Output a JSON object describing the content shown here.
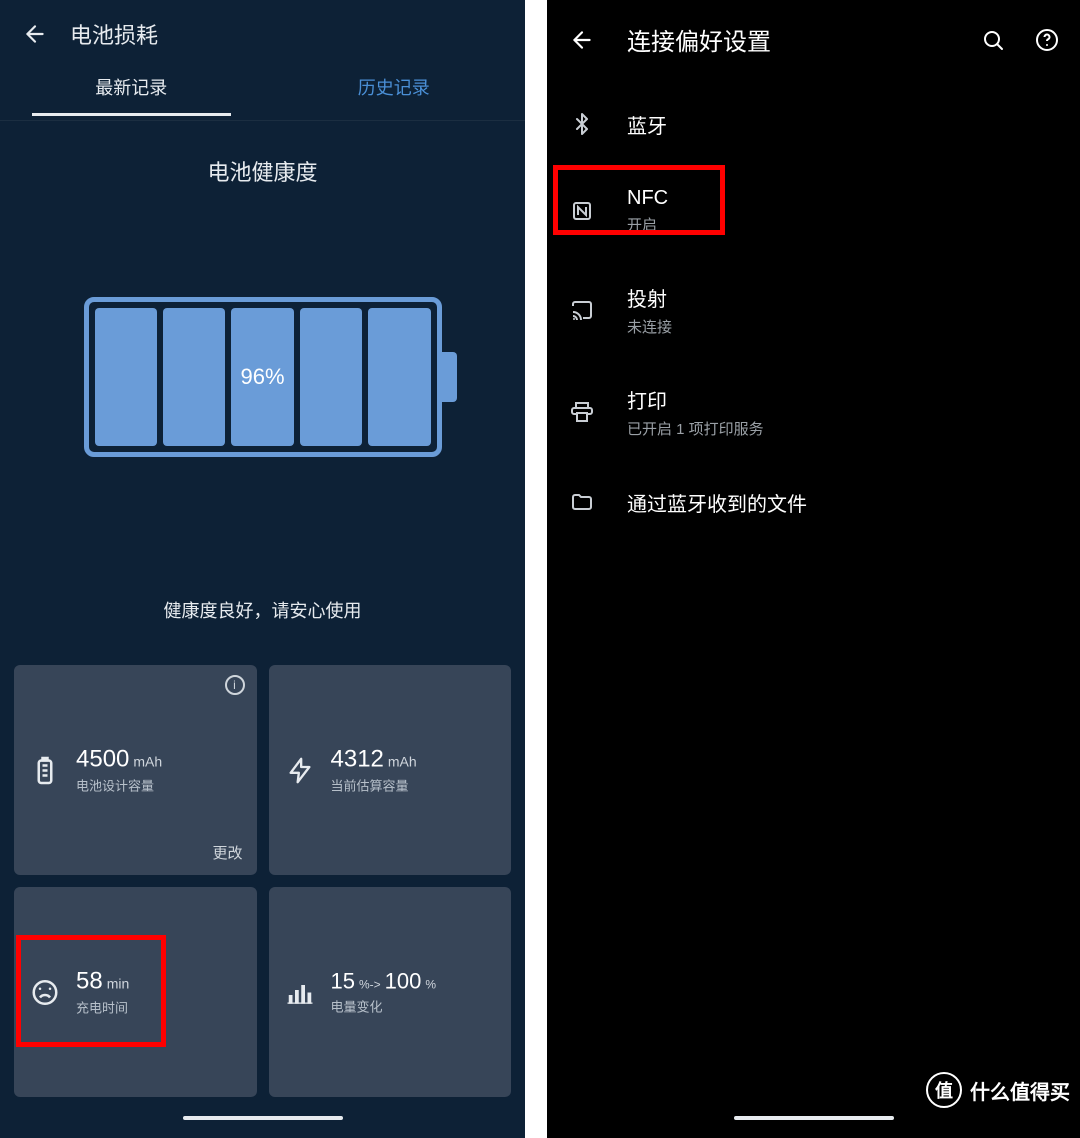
{
  "left": {
    "header": {
      "title": "电池损耗"
    },
    "tabs": {
      "latest": "最新记录",
      "history": "历史记录"
    },
    "battery_health": {
      "title": "电池健康度",
      "percent": "96%",
      "caption": "健康度良好，请安心使用"
    },
    "cards": {
      "design": {
        "value": "4500",
        "unit": "mAh",
        "label": "电池设计容量",
        "change": "更改",
        "info": "i"
      },
      "estimate": {
        "value": "4312",
        "unit": "mAh",
        "label": "当前估算容量"
      },
      "charge": {
        "value": "58",
        "unit": "min",
        "label": "充电时间"
      },
      "delta": {
        "from": "15",
        "to": "100",
        "pct_a": "%->",
        "pct_b": "%",
        "label": "电量变化"
      }
    }
  },
  "right": {
    "header": {
      "title": "连接偏好设置"
    },
    "items": {
      "bluetooth": {
        "title": "蓝牙"
      },
      "nfc": {
        "title": "NFC",
        "sub": "开启"
      },
      "cast": {
        "title": "投射",
        "sub": "未连接"
      },
      "print": {
        "title": "打印",
        "sub": "已开启 1 项打印服务"
      },
      "btfiles": {
        "title": "通过蓝牙收到的文件"
      }
    }
  },
  "watermark": {
    "badge": "值",
    "text": "什么值得买"
  }
}
